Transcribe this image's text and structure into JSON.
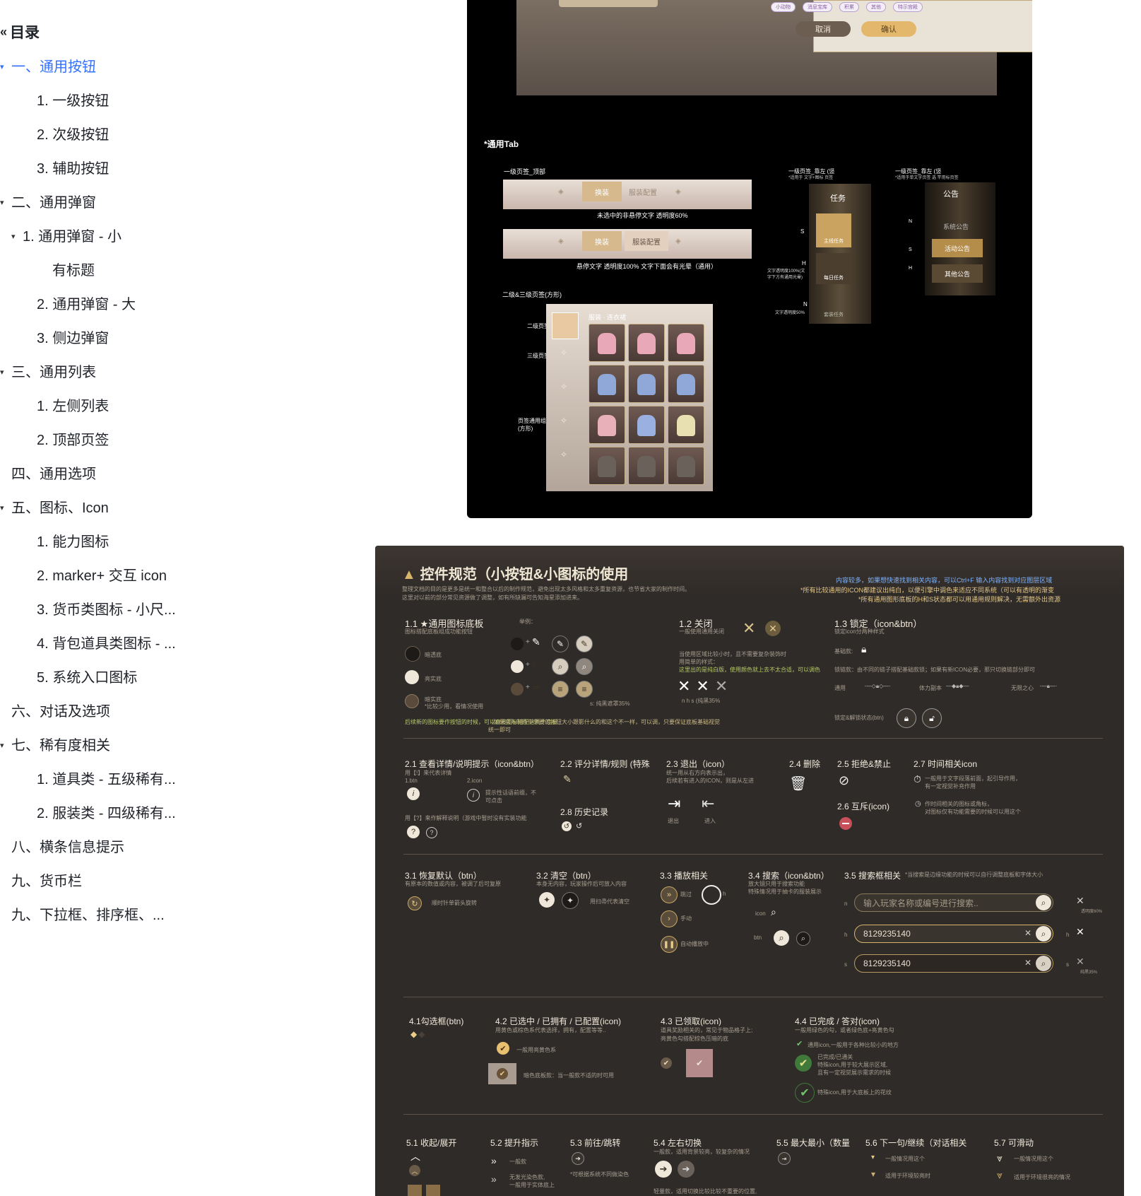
{
  "toc": {
    "title": "目录",
    "items": [
      {
        "label": "一、通用按钮",
        "active": true,
        "arrow": "▾"
      },
      {
        "label": "1.  一级按钮"
      },
      {
        "label": "2.  次级按钮"
      },
      {
        "label": "3.  辅助按钮"
      },
      {
        "label": "二、通用弹窗",
        "arrow": "▾"
      },
      {
        "label": "1.  通用弹窗 - 小",
        "arrow": "▾"
      },
      {
        "label": "有标题"
      },
      {
        "label": "2.  通用弹窗 - 大"
      },
      {
        "label": "3.  侧边弹窗"
      },
      {
        "label": "三、通用列表",
        "arrow": "▾"
      },
      {
        "label": "1.  左侧列表"
      },
      {
        "label": "2.  顶部页签"
      },
      {
        "label": "四、通用选项"
      },
      {
        "label": "五、图标、Icon",
        "arrow": "▾"
      },
      {
        "label": "1.  能力图标"
      },
      {
        "label": "2.  marker+ 交互 icon"
      },
      {
        "label": "3.  货币类图标 - 小尺..."
      },
      {
        "label": "4.  背包道具类图标 - ..."
      },
      {
        "label": "5.  系统入口图标"
      },
      {
        "label": "六、对话及选项"
      },
      {
        "label": "七、稀有度相关",
        "arrow": "▾"
      },
      {
        "label": "1.  道具类 - 五级稀有..."
      },
      {
        "label": "2.  服装类 - 四级稀有..."
      },
      {
        "label": "八、横条信息提示"
      },
      {
        "label": "九、货币栏"
      },
      {
        "label": "九、下拉框、排序框、..."
      }
    ]
  },
  "panel1": {
    "dialog_cancel": "取消",
    "dialog_confirm": "确认",
    "chips": [
      "小动物",
      "消息宝库",
      "积累",
      "其他",
      "特示宫殿"
    ],
    "tab_section": "*通用Tab",
    "top_tab_label": "一级页签_顶部",
    "tab_a": "换装",
    "tab_b": "服装配置",
    "note_unhover": "未选中的非悬停文字  透明度60%",
    "note_hover": "悬停文字  透明度100%  文字下面会有光晕（通用）",
    "square_tab_label": "二级&三级页签(方形)",
    "side_label_left": "一级页签_靠左 (竖",
    "side_sub_left": "*适用于 文字+图标 页签",
    "side_label_right": "一级页签_靠左 (竖",
    "side_sub_right": "*适用于单文字页签 选 竿用标页签",
    "task_title": "任务",
    "task_main": "主线任务",
    "task_daily": "每日任务",
    "task_side": "套装任务",
    "notice_title": "公告",
    "notice_system": "系统公告",
    "notice_event": "活动公告",
    "notice_other": "其他公告",
    "state_s": "S",
    "state_h": "H",
    "state_n": "N",
    "note_h": "文字透明度100%(文字下方有通用光晕)",
    "note_n": "文字透明度50%",
    "l2_tab": "二级页签",
    "l3_tab": "三级页签",
    "tab_general": "页签通用组件(方形)",
    "outfit_header": "服装 · 连衣裙"
  },
  "panel2": {
    "title": "控件规范（小按钮&小图标的使用",
    "intro_1": "整理文档的目的是更多是统一和整合以后的制作规范，避免出现太多风格和太多重复资源，也节省大家的制作时间。",
    "intro_2": "这里对以前的部分常见资源做了调整，如有所缺漏可告知海星添加进来。",
    "tip_1": "内容较多，如果想快速找到相关内容，可以Ctrl+F 输入内容找到对应图层区域",
    "tip_2": "*所有比较通用的ICON都建议出纯白，以便引擎中调色来适应不同系统（可以有透明的渐变",
    "tip_3": "*所有通用图形底板的H和S状态都可以用通用规则解决，无需额外出资源",
    "s11_title": "1.1 ★通用图标底板",
    "s11_sub": "图标搭配底板组成功能按钮",
    "s11_example": "举例：",
    "s11_dark": "暗透底",
    "s11_light": "亮实底",
    "s11_darksolid": "暗实底",
    "s11_darksolid_note": "*比较少用，看情况使用",
    "s11_s_note": "s: 纯黑遮罩35%",
    "s11_foot_1": "后续新的图标要作按钮的时候，可以直接图标搭配这两个底板",
    "s11_foot_2": "（如果实际制作中想要的按钮大小跟影什么的和这个不一样，可以调，只要保证底板基础视觉统一即可",
    "s12_title": "1.2 关闭",
    "s12_sub": "一般使用通用关闭",
    "s12_note_1": "当使用区域比较小时，且不需要复杂装饰时",
    "s12_note_2": "用简单的样式：",
    "s12_note_3": "这里出的是纯白版，使用颜色就上去不太合适，可以调色",
    "s12_states": "n      h      s (纯黑35%",
    "s13_title": "1.3 锁定（icon&btn）",
    "s13_sub": "锁定icon分两种样式",
    "s13_basic": "基础款:",
    "s13_chain": "锁链款：由不同的链子搭配基础款锁；如果有新ICON必要，那只切换链部分即可",
    "s13_universal": "通用",
    "s13_stamina": "体力副本",
    "s13_infinite": "无限之心",
    "s13_unlock": "锁定&解锁状态(btn)",
    "s21_title": "2.1 查看详情/说明提示（icon&btn）",
    "s21_sub": "用【!】来代表详情",
    "s21_btn": "1.btn",
    "s21_icon": "2.icon",
    "s21_icon_note": "提示性话语前缀，不可点击",
    "s21_q": "用【?】来作解释说明（游戏中暂时没有实装功能",
    "s22_title": "2.2 评分详情/规则 (特殊",
    "s28_title": "2.8 历史记录",
    "s23_title": "2.3 退出（icon）",
    "s23_sub_1": "统一用从右方向表示出，",
    "s23_sub_2": "后续若有进入的ICON，则是从左进",
    "s23_exit": "退出",
    "s23_enter": "进入",
    "s24_title": "2.4 删除",
    "s25_title": "2.5 拒绝&禁止",
    "s26_title": "2.6 互斥(icon)",
    "s27_title": "2.7 时间相关icon",
    "s27_note_1": "一般用于文字段落前面，起引导作用，",
    "s27_note_2": "有一定视觉补充作用",
    "s27_note_3": "作时间相关的图标或角标，",
    "s27_note_4": "对图标仅有功能需要的时候可以用这个",
    "s31_title": "3.1 恢复默认（btn）",
    "s31_sub": "有原本的数值或内容，被调了后可复原",
    "s31_note": "顺时针单箭头旋转",
    "s32_title": "3.2 清空（btn）",
    "s32_sub": "本身无内容，玩家操作后可放入内容",
    "s32_note": "用扫帚代表清空",
    "s33_title": "3.3 播放相关",
    "s33_skip": "跳过",
    "s33_manual": "手动",
    "s33_auto": "自动播放中",
    "s34_title": "3.4 搜索（icon&btn）",
    "s34_sub_1": "放大镜只用于搜索功能",
    "s34_sub_2": "特殊情况用于抽卡的服装展示",
    "s34_icon": "icon",
    "s34_btn": "btn",
    "s35_title": "3.5 搜索框相关",
    "s35_note": "*当搜索是边缘功能的时候可以自行调整底板和字体大小",
    "search_placeholder": "输入玩家名称或编号进行搜索..",
    "search_value_h": "8129235140",
    "search_value_s": "8129235140",
    "side_n_note": "透明度60%",
    "side_s_note": "纯黑35%",
    "s41_title": "4.1勾选框(btn)",
    "s42_title": "4.2 已选中 / 已拥有 / 已配置(icon)",
    "s42_sub": "用黄色或棕色系代表选择，拥有，配置等等..",
    "s42_gold": "一般用亮黄色系",
    "s42_dark": "暗色底板款：当一般款不适的时可用",
    "s43_title": "4.3 已领取(icon)",
    "s43_sub_1": "道具奖励相关的，常见于物品格子上;",
    "s43_sub_2": "亮黄色勾搭配棕色压暗的底",
    "s44_title": "4.4 已完成 / 答对(icon)",
    "s44_sub": "一般用绿色的勾，或者绿色底+亮黄色勾",
    "s44_a": "通用icon,一般用于各种比较小的地方",
    "s44_b1": "已完成/已通关",
    "s44_b2": "特殊icon,用于较大展示区域,",
    "s44_b3": "且有一定视觉展示需求的时候",
    "s44_c": "特殊icon,用于大底板上的花纹",
    "s51_title": "5.1 收起/展开",
    "s52_title": "5.2 提升指示",
    "s52_a": "一般款",
    "s52_b": "无发光染色款,",
    "s52_c": "一般用于实体底上",
    "s53_title": "5.3 前往/跳转",
    "s53_note": "*可根据系统不同做染色",
    "s54_title": "5.4 左右切换",
    "s54_sub": "一般款，适用背景较亮，较复杂的情况",
    "s54_foot": "轻量款，适用切换比较比较不重要的位置,",
    "s55_title": "5.5 最大最小（数量",
    "s56_title": "5.6 下一句/继续（对话相关",
    "s56_a": "一般情况用这个",
    "s56_b": "适用于环境较亮时",
    "s57_title": "5.7 可滑动",
    "s57_a": "一般情况用这个",
    "s57_b": "适用于环境很亮的情况",
    "n": "n",
    "h": "h",
    "s": "s"
  }
}
